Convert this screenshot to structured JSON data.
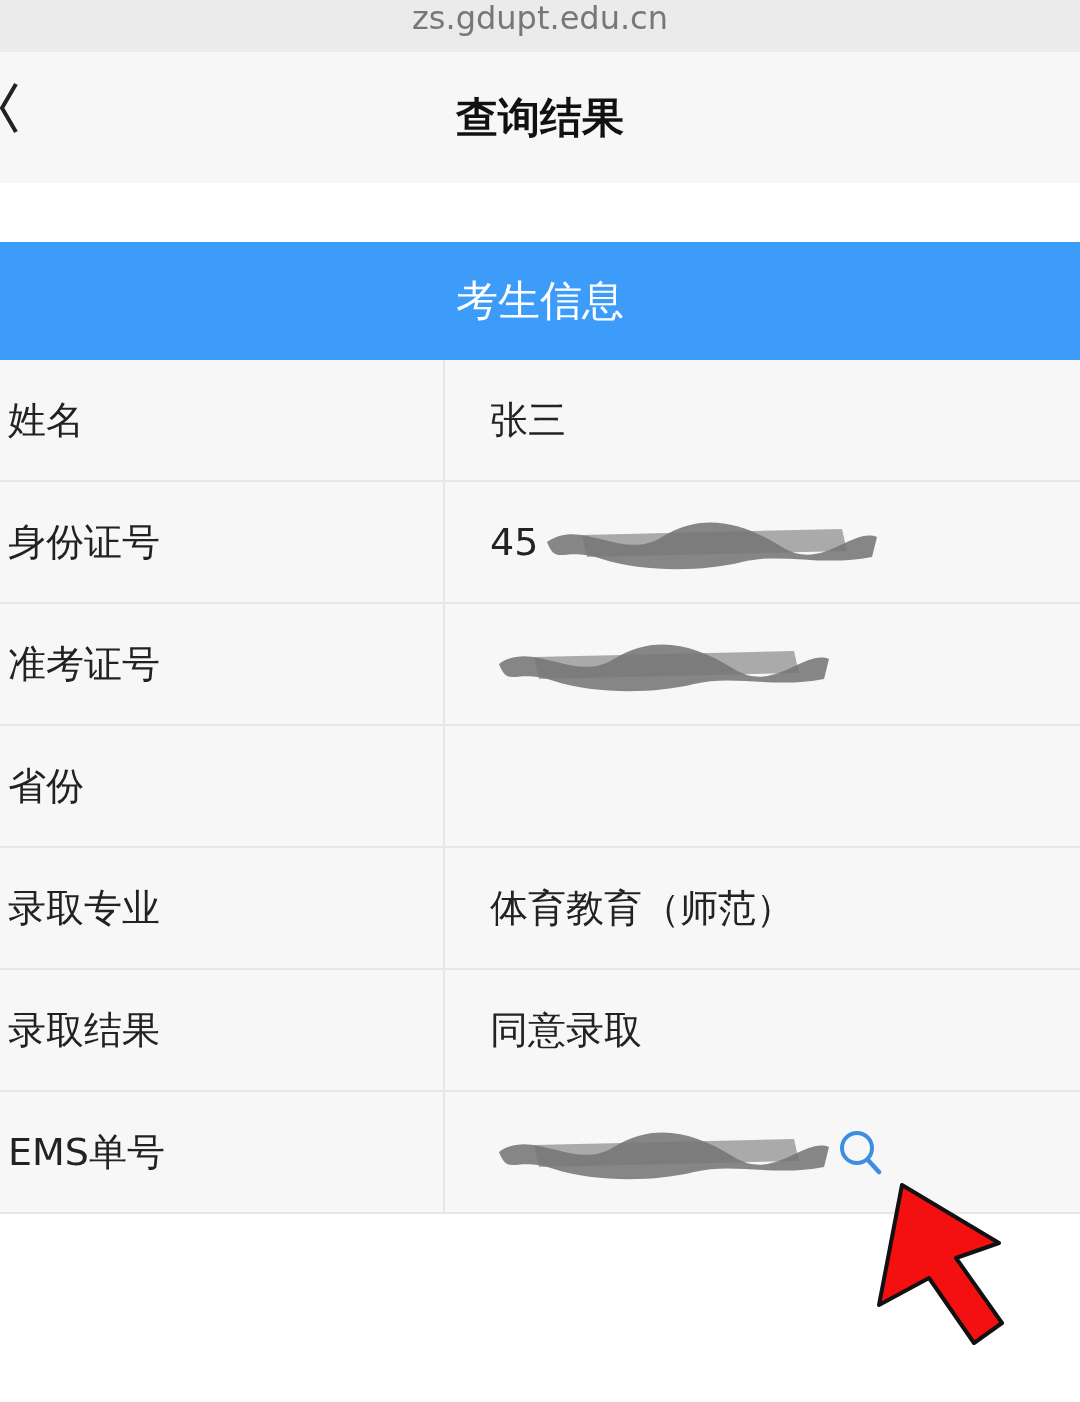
{
  "address_bar": {
    "url": "zs.gdupt.edu.cn"
  },
  "header": {
    "title": "查询结果"
  },
  "section": {
    "title": "考生信息"
  },
  "rows": [
    {
      "label": "姓名",
      "value": "张三",
      "redacted": false,
      "kind": "text"
    },
    {
      "label": "身份证号",
      "value": "45",
      "redacted": true,
      "kind": "text"
    },
    {
      "label": "准考证号",
      "redacted": true,
      "kind": "text"
    },
    {
      "label": "省份",
      "redacted": false,
      "kind": "text"
    },
    {
      "label": "录取专业",
      "value": "体育教育（师范）",
      "redacted": false,
      "kind": "text"
    },
    {
      "label": "录取结果",
      "value": "同意录取",
      "redacted": false,
      "kind": "text"
    },
    {
      "label": "EMS单号",
      "redacted": true,
      "kind": "tracking"
    }
  ]
}
